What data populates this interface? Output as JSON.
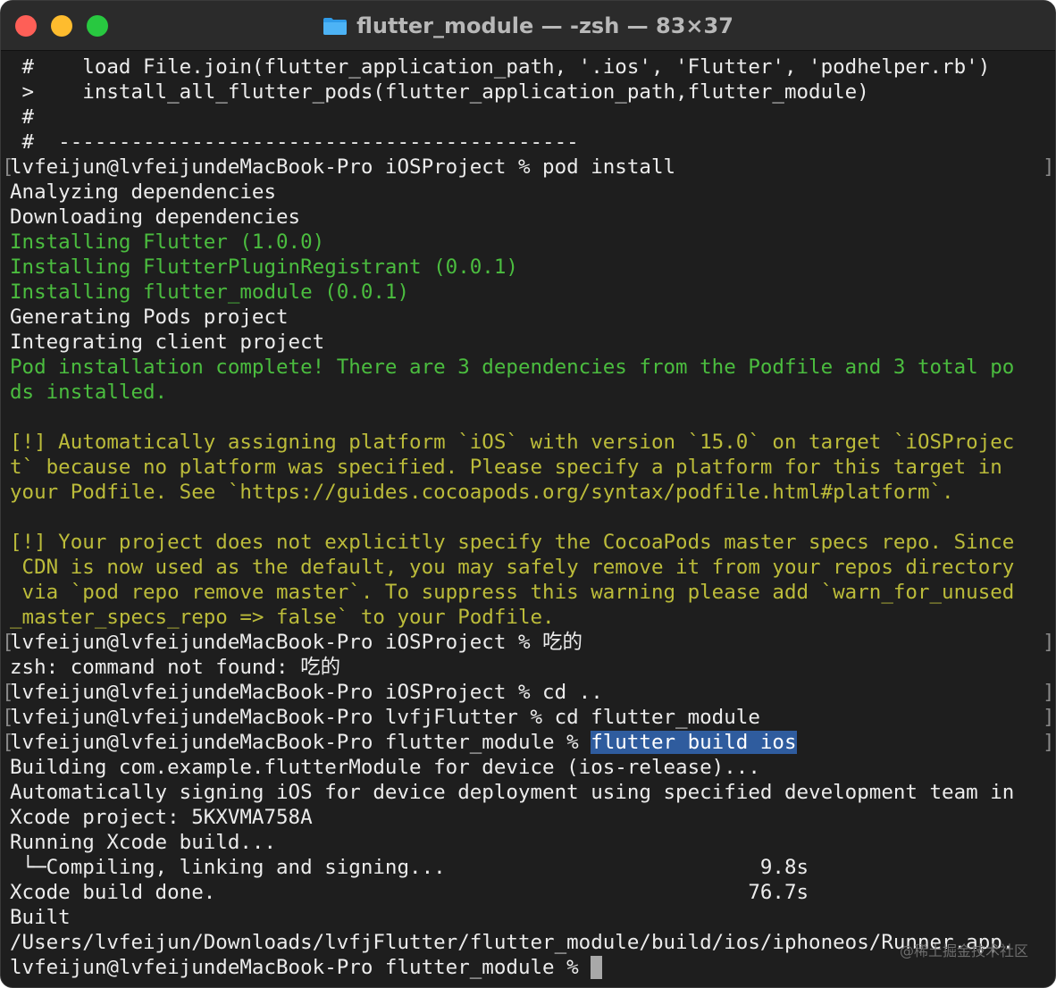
{
  "window": {
    "title": "flutter_module — -zsh — 83×37",
    "folder_icon": "folder-icon",
    "colors": {
      "background": "#1e1e1e",
      "green": "#4bbd3f",
      "yellow": "#bcbc3a",
      "selection": "#2f5c9e"
    }
  },
  "terminal": {
    "lines": [
      " #    load File.join(flutter_application_path, '.ios', 'Flutter', 'podhelper.rb')",
      " >    install_all_flutter_pods(flutter_application_path,flutter_module)",
      " #",
      " #  -------------------------------------------",
      "lvfeijun@lvfeijundeMacBook-Pro iOSProject % pod install",
      "Analyzing dependencies",
      "Downloading dependencies",
      "Installing Flutter (1.0.0)",
      "Installing FlutterPluginRegistrant (0.0.1)",
      "Installing flutter_module (0.0.1)",
      "Generating Pods project",
      "Integrating client project",
      "Pod installation complete! There are 3 dependencies from the Podfile and 3 total po",
      "ds installed.",
      "",
      "[!] Automatically assigning platform `iOS` with version `15.0` on target `iOSProjec",
      "t` because no platform was specified. Please specify a platform for this target in",
      "your Podfile. See `https://guides.cocoapods.org/syntax/podfile.html#platform`.",
      "",
      "[!] Your project does not explicitly specify the CocoaPods master specs repo. Since",
      " CDN is now used as the default, you may safely remove it from your repos directory",
      " via `pod repo remove master`. To suppress this warning please add `warn_for_unused",
      "_master_specs_repo => false` to your Podfile.",
      "lvfeijun@lvfeijundeMacBook-Pro iOSProject % 吃的",
      "zsh: command not found: 吃的",
      "lvfeijun@lvfeijundeMacBook-Pro iOSProject % cd ..",
      "lvfeijun@lvfeijundeMacBook-Pro lvfjFlutter % cd flutter_module",
      "lvfeijun@lvfeijundeMacBook-Pro flutter_module % ",
      "Building com.example.flutterModule for device (ios-release)...",
      "Automatically signing iOS for device deployment using specified development team in",
      "Xcode project: 5KXVMA758A",
      "Running Xcode build...",
      " └─Compiling, linking and signing...                          9.8s",
      "Xcode build done.                                            76.7s",
      "Built",
      "/Users/lvfeijun/Downloads/lvfjFlutter/flutter_module/build/ios/iphoneos/Runner.app.",
      "lvfeijun@lvfeijundeMacBook-Pro flutter_module % "
    ],
    "selected_command": "flutter build ios",
    "prompt_bracket_left": "[",
    "prompt_bracket_right": "]"
  },
  "watermark": "@稀土掘金技术社区"
}
